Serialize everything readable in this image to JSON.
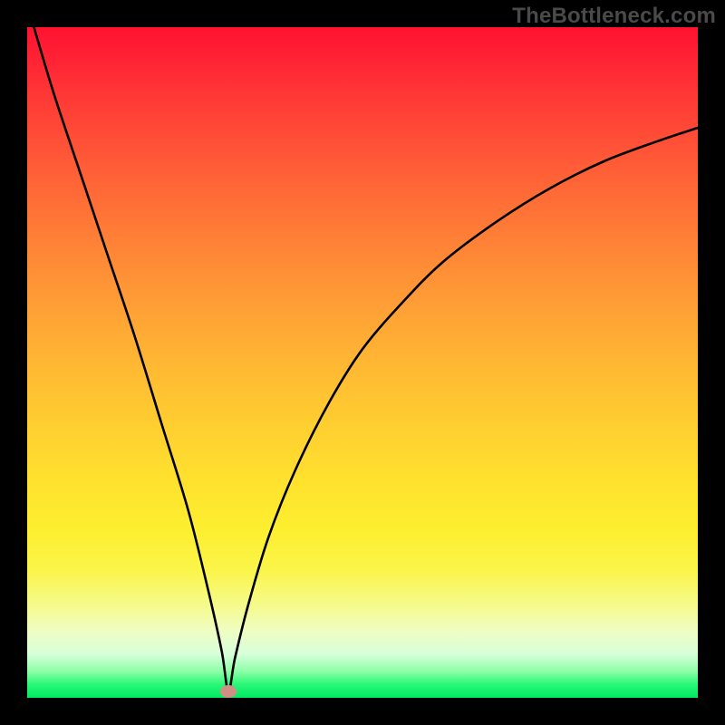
{
  "watermark": "TheBottleneck.com",
  "chart_data": {
    "type": "line",
    "title": "",
    "xlabel": "",
    "ylabel": "",
    "xlim": [
      0,
      100
    ],
    "ylim": [
      0,
      100
    ],
    "grid": false,
    "legend": false,
    "background_gradient": {
      "direction": "vertical",
      "stops": [
        {
          "pos": 0,
          "color": "#ff1330",
          "meaning": "high-bottleneck"
        },
        {
          "pos": 50,
          "color": "#ffb733",
          "meaning": "mid"
        },
        {
          "pos": 100,
          "color": "#00ea62",
          "meaning": "no-bottleneck"
        }
      ]
    },
    "optimum_marker": {
      "x": 30,
      "y": 1,
      "color": "#d08f86"
    },
    "series": [
      {
        "name": "bottleneck-curve",
        "x": [
          1,
          4,
          8,
          12,
          16,
          20,
          24,
          27,
          29,
          30,
          31,
          33,
          36,
          40,
          45,
          50,
          56,
          62,
          70,
          78,
          86,
          94,
          100
        ],
        "values": [
          100,
          90,
          78,
          66,
          54,
          41,
          28,
          16,
          7,
          1,
          6,
          14,
          24,
          34,
          44,
          52,
          59,
          65,
          71,
          76,
          80,
          83,
          85
        ]
      }
    ]
  }
}
